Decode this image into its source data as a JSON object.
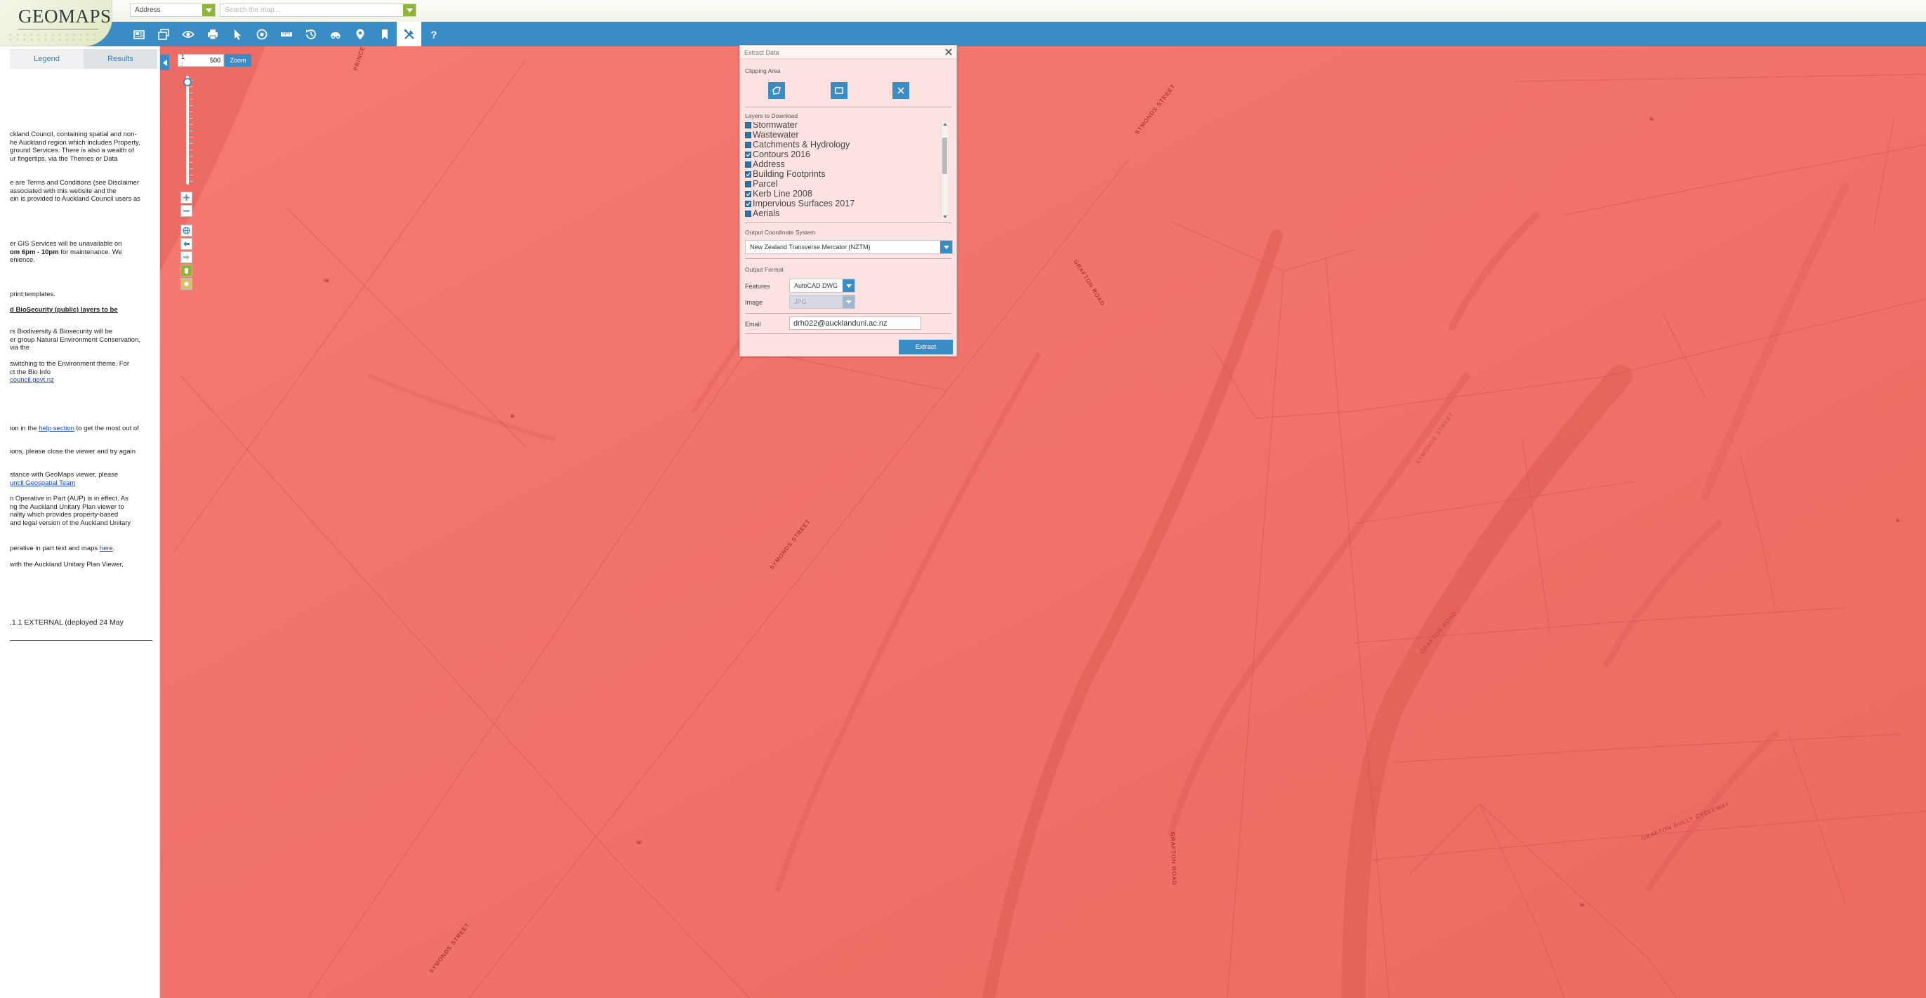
{
  "app": {
    "logo_text": "GEOMAPS"
  },
  "search": {
    "category_value": "Address",
    "placeholder": "Search the map..."
  },
  "toolbar": {
    "tools": [
      {
        "name": "layers-catalog",
        "icon": "catalog-icon"
      },
      {
        "name": "layer-stack",
        "icon": "layers-icon"
      },
      {
        "name": "view",
        "icon": "eye-icon"
      },
      {
        "name": "print",
        "icon": "print-icon"
      },
      {
        "name": "select",
        "icon": "pointer-icon"
      },
      {
        "name": "locate",
        "icon": "target-icon"
      },
      {
        "name": "measure",
        "icon": "ruler-icon"
      },
      {
        "name": "history",
        "icon": "history-icon"
      },
      {
        "name": "streetview",
        "icon": "car-icon"
      },
      {
        "name": "placemark",
        "icon": "pin-icon"
      },
      {
        "name": "bookmark",
        "icon": "bookmark-icon"
      },
      {
        "name": "tools",
        "icon": "tools-icon",
        "active": true
      },
      {
        "name": "help",
        "icon": "help-icon"
      }
    ]
  },
  "left_panel": {
    "tabs": [
      "Legend",
      "Results"
    ],
    "p1": [
      "ckland Council, containing spatial and non-",
      "he Auckland region which includes Property,",
      "ground Services. There is also a wealth of",
      "ur fingertips, via the Themes or Data"
    ],
    "p2": [
      "e are Terms and Conditions (see Disclaimer",
      "associated with this website and the",
      "ein is provided to Auckland Council users as"
    ],
    "p3_line1": "er GIS Services will be unavailable on",
    "p3_line2_bold": "om 6pm - 10pm",
    "p3_line2_rest": " for maintenance. We",
    "p3_line3": "enience.",
    "p4": "print templates.",
    "p5_bold": "d BioSecurity (public) layers to be",
    "p6": [
      "rs Biodiversity & Biosecurity will be",
      "er group Natural Environment Conservation,",
      " via the"
    ],
    "p7": [
      "switching to the Environment theme. For",
      "ct the Bio Info"
    ],
    "p7_link": "council.govt.nz",
    "p8_pre": "ion in the ",
    "p8_link": "help section",
    "p8_post": " to get the most out of",
    "p9": "ions, please close the viewer and try again",
    "p10": "stance with GeoMaps viewer, please",
    "p10_link": "uncil Geospatial Team",
    "p11": [
      "n Operative in Part (AUP) is in effect. As",
      "ng the Auckland Unitary Plan viewer to",
      "nality which provides property-based",
      "and legal version of the Auckland Unitary"
    ],
    "p12_pre": "perative in part text and maps ",
    "p12_link": "here",
    "p12_post": ".",
    "p13": " with the Auckland Unitary Plan Viewer,",
    "version": ".1.1 EXTERNAL (deployed 24 May"
  },
  "map": {
    "scale_prefix": "1 :",
    "scale_value": "500",
    "zoom_label": "Zoom",
    "slider_level_fraction": 0.02,
    "streets": [
      "PRINCES",
      "SYMONDS STREET",
      "GRAFTON ROAD",
      "SYMONDS STREET",
      "GRAFTON ROAD",
      "SYMONDS STREET",
      "GRAFTON ROAD",
      "SYMONDS STREET",
      "GRAFTON GULLY CYCLEWAY"
    ],
    "parcel_labels": [
      "92",
      "8",
      "95",
      "3",
      "3",
      "75"
    ]
  },
  "extract_dialog": {
    "title": "Extract Data",
    "clipping_area_label": "Clipping Area",
    "clip_tools": [
      "polygon-icon",
      "rectangle-icon",
      "clear-icon"
    ],
    "layers_label": "Layers to Download",
    "layers": [
      {
        "name": "Stormwater",
        "checked": false
      },
      {
        "name": "Wastewater",
        "checked": false
      },
      {
        "name": "Catchments & Hydrology",
        "checked": false
      },
      {
        "name": "Contours 2016",
        "checked": true
      },
      {
        "name": "Address",
        "checked": false
      },
      {
        "name": "Building Footprints",
        "checked": true
      },
      {
        "name": "Parcel",
        "checked": false
      },
      {
        "name": "Kerb Line 2008",
        "checked": true
      },
      {
        "name": "Impervious Surfaces 2017",
        "checked": true
      },
      {
        "name": "Aerials",
        "checked": false
      }
    ],
    "coord_label": "Output Coordinate System",
    "coord_value": "New Zealand Transverse Mercator (NZTM)",
    "format_label": "Output Format",
    "features_label": "Features",
    "features_value": "AutoCAD DWG",
    "image_label": "Image",
    "image_value": "JPG",
    "email_label": "Email",
    "email_value": "drh022@aucklanduni.ac.nz",
    "extract_label": "Extract"
  },
  "colors": {
    "toolbar_blue": "#3a8cc4",
    "map_overlay": "#f27068",
    "search_green": "#8fb43c",
    "dialog_bg": "#fce3e1"
  }
}
